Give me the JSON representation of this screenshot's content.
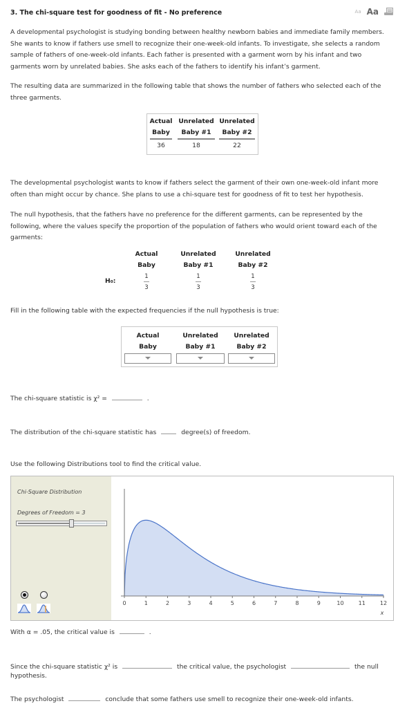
{
  "header": {
    "title": "3.  The chi-square test for goodness of fit - No preference",
    "text_small_label": "Aa",
    "text_large_label": "Aa",
    "print_icon": "printer-icon"
  },
  "paragraphs": {
    "intro": "A developmental psychologist is studying bonding between healthy newborn babies and immediate family members. She wants to know if fathers use smell to recognize their one-week-old infants. To investigate, she selects a random sample of fathers of one-week-old infants. Each father is presented with a garment worn by his infant and two garments worn by unrelated babies. She asks each of the fathers to identify his infant’s garment.",
    "data_intro": "The resulting data are summarized in the following table that shows the number of fathers who selected each of the three garments.",
    "test_intro": "The developmental psychologist wants to know if fathers select the garment of their own one-week-old infant more often than might occur by chance. She plans to use a chi-square test for goodness of fit to test her hypothesis.",
    "null_intro": "The null hypothesis, that the fathers have no preference for the different garments, can be represented by the following, where the values specify the proportion of the population of fathers who would orient toward each of the garments:",
    "expected_intro": "Fill in the following table with the expected frequencies if the null hypothesis is true:"
  },
  "observed_table": {
    "columns": [
      {
        "line1": "Actual",
        "line2": "Baby",
        "value": "36"
      },
      {
        "line1": "Unrelated",
        "line2": "Baby #1",
        "value": "18"
      },
      {
        "line1": "Unrelated",
        "line2": "Baby #2",
        "value": "22"
      }
    ]
  },
  "null_hypothesis": {
    "label": "H₀:",
    "columns": [
      {
        "line1": "Actual",
        "line2": "Baby",
        "num": "1",
        "den": "3"
      },
      {
        "line1": "Unrelated",
        "line2": "Baby #1",
        "num": "1",
        "den": "3"
      },
      {
        "line1": "Unrelated",
        "line2": "Baby #2",
        "num": "1",
        "den": "3"
      }
    ]
  },
  "expected_table": {
    "columns": [
      {
        "line1": "Actual",
        "line2": "Baby",
        "selected": ""
      },
      {
        "line1": "Unrelated",
        "line2": "Baby #1",
        "selected": ""
      },
      {
        "line1": "Unrelated",
        "line2": "Baby #2",
        "selected": ""
      }
    ]
  },
  "questions": {
    "chi_square_prefix": "The chi-square statistic is χ² =",
    "chi_square_value": "",
    "chi_square_suffix": ".",
    "df_prefix": "The distribution of the chi-square statistic has",
    "df_value": "",
    "df_suffix": "degree(s) of freedom.",
    "tool_intro": "Use the following Distributions tool to find the critical value.",
    "critical_prefix": "With α = .05, the critical value is",
    "critical_value": "",
    "critical_suffix": ".",
    "since_prefix": "Since the chi-square statistic χ² is",
    "since_value": "",
    "since_middle": "the critical value, the psychologist",
    "decision_value": "",
    "since_suffix": "the null",
    "since_line2": "hypothesis.",
    "conclude_prefix": "The psychologist",
    "conclude_value": "",
    "conclude_suffix": "conclude that some fathers use smell to recognize their one-week-old infants."
  },
  "distribution_tool": {
    "title": "Chi-Square Distribution",
    "df_label": "Degrees of Freedom = 3",
    "slider_fraction": 0.6,
    "radio_options": [
      {
        "name": "density-curve",
        "selected": true
      },
      {
        "name": "critical-region",
        "selected": false
      }
    ],
    "colors": {
      "curve": "#4a74c9",
      "fill": "#d3def3",
      "marker": "#e8a040",
      "sidebar": "#ebebdc"
    }
  },
  "chart_data": {
    "type": "area",
    "title": "Chi-Square Distribution",
    "distribution": "chi-square",
    "df": 3,
    "xlabel": "x",
    "ylabel": "",
    "xlim": [
      0,
      12
    ],
    "x_ticks": [
      "0",
      "1",
      "2",
      "3",
      "4",
      "5",
      "6",
      "7",
      "8",
      "9",
      "10",
      "11",
      "12"
    ],
    "x": [
      0,
      0.25,
      0.5,
      1,
      1.5,
      2,
      3,
      4,
      5,
      6,
      7,
      8,
      9,
      10,
      11,
      12
    ],
    "y": [
      0,
      0.177,
      0.22,
      0.242,
      0.231,
      0.208,
      0.154,
      0.108,
      0.073,
      0.049,
      0.032,
      0.021,
      0.013,
      0.008,
      0.005,
      0.003
    ],
    "grid": false,
    "legend": "none"
  }
}
